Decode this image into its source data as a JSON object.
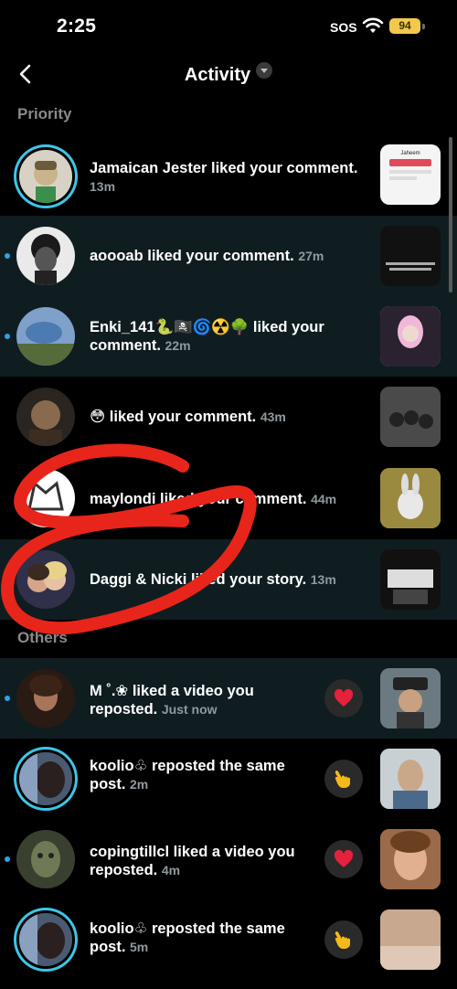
{
  "status_bar": {
    "time": "2:25",
    "carrier": "SOS",
    "battery": "94"
  },
  "header": {
    "title": "Activity"
  },
  "sections": {
    "priority": "Priority",
    "others": "Others"
  },
  "priority_items": [
    {
      "text": "Jamaican Jester liked your comment.",
      "time": "13m"
    },
    {
      "text": "aoooab liked your comment.",
      "time": "27m"
    },
    {
      "text": "Enki_141🐍🏴‍☠️🌀☢️🌳 liked your comment.",
      "time": "22m"
    },
    {
      "text": "😳 liked your comment.",
      "time": "43m"
    },
    {
      "text": "maylondi liked your comment.",
      "time": "44m"
    },
    {
      "text": "Daggi & Nicki liked your story.",
      "time": "13m"
    }
  ],
  "other_items": [
    {
      "text": "M ˚.❀ liked a video you reposted.",
      "time": "Just now",
      "reaction": "heart-icon"
    },
    {
      "text": "koolio♧ reposted the same post.",
      "time": "2m",
      "reaction": "pointing-hand-icon"
    },
    {
      "text": "copingtillcl liked a video you reposted.",
      "time": "4m",
      "reaction": "heart-icon"
    },
    {
      "text": "koolio♧ reposted the same post.",
      "time": "5m",
      "reaction": "pointing-hand-icon"
    }
  ],
  "thumbs": {
    "jamaican": "Jaheem"
  },
  "colors": {
    "unread_bg": "#0f1d21",
    "accent_dot": "#2ea3e6",
    "ring": "#3dc6e6",
    "heart": "#e5213b"
  }
}
